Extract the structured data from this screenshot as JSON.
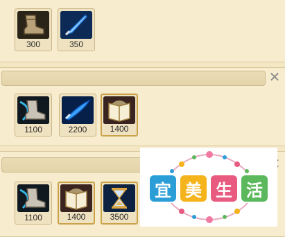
{
  "rows": [
    {
      "items": [
        {
          "name": "boots-icon",
          "price": "300"
        },
        {
          "name": "dagger-icon",
          "price": "350"
        }
      ]
    },
    {
      "items": [
        {
          "name": "speed-boots-icon",
          "price": "1100"
        },
        {
          "name": "blue-blade-icon",
          "price": "2200"
        },
        {
          "name": "spellbook-icon",
          "price": "1400"
        }
      ]
    },
    {
      "items": [
        {
          "name": "speed-boots-icon",
          "price": "1100"
        },
        {
          "name": "spellbook-icon",
          "price": "1400"
        },
        {
          "name": "hourglass-icon",
          "price": "3500"
        }
      ]
    }
  ],
  "close_glyph": "✕",
  "watermark": {
    "chars": [
      "宜",
      "美",
      "生",
      "活"
    ],
    "colors": [
      "#2b9ed8",
      "#f5b31c",
      "#e85a7f",
      "#5cb85c"
    ]
  }
}
